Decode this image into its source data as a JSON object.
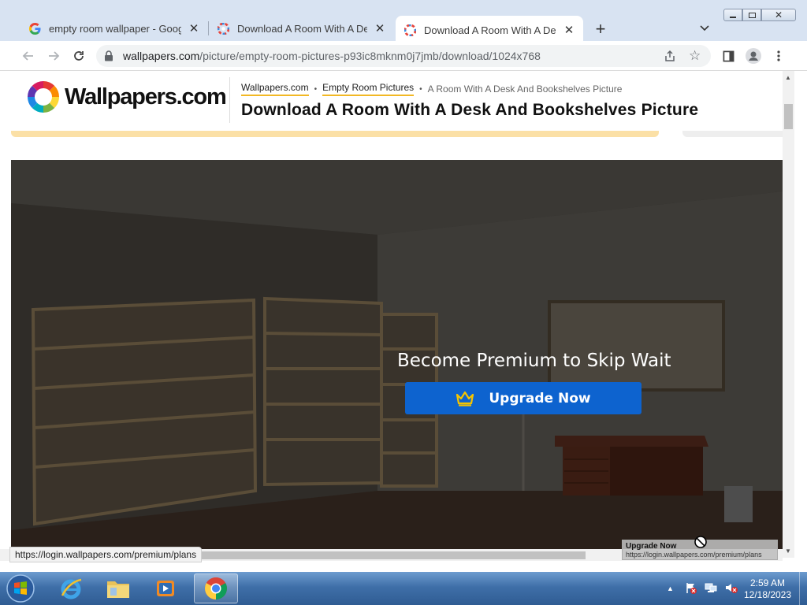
{
  "browser": {
    "tabs": [
      {
        "title": "empty room wallpaper - Google",
        "favicon": "google-g-icon",
        "active": false
      },
      {
        "title": "Download A Room With A Desk A",
        "favicon": "wallpapers-favicon",
        "active": false
      },
      {
        "title": "Download A Room With A Desk A",
        "favicon": "wallpapers-favicon",
        "active": true
      }
    ],
    "new_tab_label": "+",
    "url_host": "wallpapers.com",
    "url_path": "/picture/empty-room-pictures-p93ic8mknm0j7jmb/download/1024x768"
  },
  "page": {
    "logo_text": "Wallpapers.com",
    "breadcrumbs": [
      "Wallpapers.com",
      "Empty Room Pictures",
      "A Room With A Desk And Bookshelves Picture"
    ],
    "breadcrumb_separator": "•",
    "title": "Download A Room With A Desk And Bookshelves Picture",
    "overlay_text": "Become Premium to Skip Wait",
    "upgrade_label": "Upgrade Now"
  },
  "status": {
    "link_preview": "https://login.wallpapers.com/premium/plans",
    "tooltip_title": "Upgrade Now",
    "tooltip_url": "https://login.wallpapers.com/premium/plans"
  },
  "taskbar": {
    "apps": [
      "internet-explorer",
      "file-explorer",
      "media-player",
      "google-chrome"
    ],
    "time": "2:59 AM",
    "date": "12/18/2023"
  },
  "colors": {
    "accent_blue": "#0d63cf",
    "crumb_underline": "#f2b824",
    "crown_yellow": "#f5c400"
  }
}
